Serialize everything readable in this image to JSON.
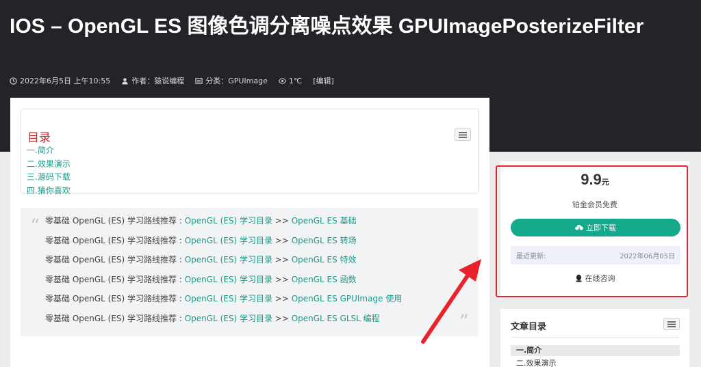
{
  "article": {
    "title": "IOS – OpenGL ES 图像色调分离噪点效果 GPUImagePosterizeFilter",
    "meta": {
      "date": "2022年6月5日 上午10:55",
      "author": "作者：猿说编程",
      "category": "分类：GPUImage",
      "views": "1℃",
      "edit": "[编辑]"
    }
  },
  "toc": {
    "title": "目录",
    "items": [
      "一.简介",
      "二.效果演示",
      "三.源码下载",
      "四.猜你喜欢"
    ]
  },
  "quote": {
    "prefix": "零基础 OpenGL (ES) 学习路线推荐 : ",
    "sep": " >> ",
    "lines": [
      {
        "link1": "OpenGL (ES) 学习目录",
        "link2": "OpenGL ES 基础"
      },
      {
        "link1": "OpenGL (ES) 学习目录",
        "link2": "OpenGL ES 转场"
      },
      {
        "link1": "OpenGL (ES) 学习目录",
        "link2": "OpenGL ES 特效"
      },
      {
        "link1": "OpenGL (ES) 学习目录",
        "link2": "OpenGL ES 函数"
      },
      {
        "link1": "OpenGL (ES) 学习目录",
        "link2": "OpenGL ES GPUImage 使用"
      },
      {
        "link1": "OpenGL (ES) 学习目录",
        "link2": "OpenGL ES GLSL 编程"
      }
    ]
  },
  "purchase": {
    "price": "9.9",
    "unit": "元",
    "free_note": "铂金会员免费",
    "download_label": "立即下载",
    "update_label": "最近更新:",
    "update_date": "2022年06月05日",
    "consult_label": "在线咨询"
  },
  "sidebar_toc": {
    "title": "文章目录",
    "items": [
      "一.简介",
      "二.效果演示"
    ]
  },
  "colors": {
    "link": "#1a9a8a",
    "button": "#13a98a",
    "toc_title": "#c02b2b",
    "highlight": "#e8232c",
    "hero_bg": "#232427"
  }
}
